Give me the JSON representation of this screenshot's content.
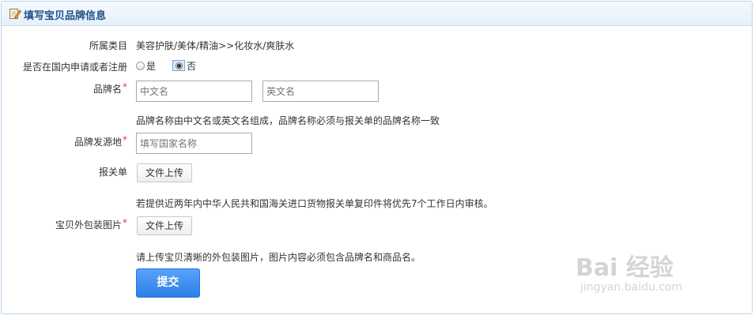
{
  "header": {
    "title": "填写宝贝品牌信息",
    "icon": "edit-icon"
  },
  "category": {
    "label": "所属类目",
    "value": "美容护肤/美体/精油>>化妆水/爽肤水"
  },
  "registered": {
    "label": "是否在国内申请或者注册",
    "options": [
      {
        "label": "是",
        "checked": false
      },
      {
        "label": "否",
        "checked": true
      }
    ]
  },
  "brand": {
    "label": "品牌名",
    "required_mark": "*",
    "cn_placeholder": "中文名",
    "en_placeholder": "英文名",
    "hint": "品牌名称由中文名或英文名组成，品牌名称必须与报关单的品牌名称一致"
  },
  "origin": {
    "label": "品牌发源地",
    "required_mark": "*",
    "placeholder": "填写国家名称"
  },
  "customs": {
    "label": "报关单",
    "upload_label": "文件上传",
    "hint": "若提供近两年内中华人民共和国海关进口货物报关单复印件将优先7个工作日内审核。"
  },
  "package": {
    "label": "宝贝外包装图片",
    "required_mark": "*",
    "upload_label": "文件上传",
    "hint": "请上传宝贝清晰的外包装图片，图片内容必须包含品牌名和商品名。"
  },
  "submit_label": "提交",
  "watermark": {
    "main": "Bai 经验",
    "sub": "jingyan.baidu.com"
  },
  "colors": {
    "accent": "#2c7ee8",
    "header_text": "#1d4f87",
    "required": "#e4393c",
    "border": "#bcd3ea"
  }
}
